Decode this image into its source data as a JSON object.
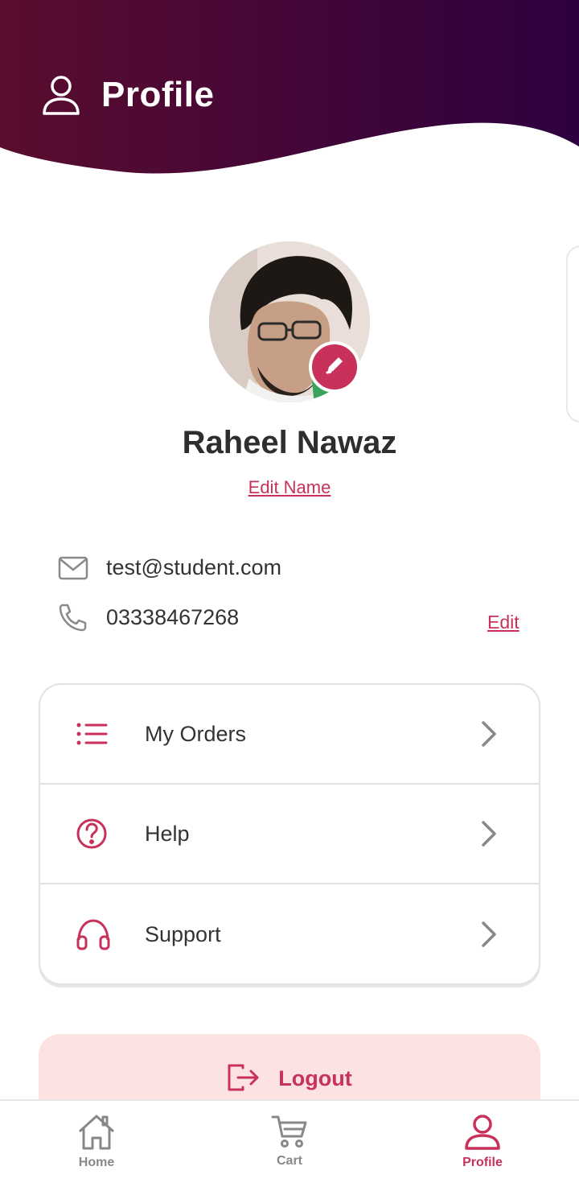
{
  "colors": {
    "accent": "#c8315a",
    "header_gradient_start": "#5a0d2e",
    "header_gradient_end": "#2e0040",
    "logout_bg": "#fde2e2"
  },
  "header": {
    "title": "Profile",
    "icon": "person-icon"
  },
  "profile": {
    "name": "Raheel Nawaz",
    "edit_name_label": "Edit Name",
    "email": "test@student.com",
    "phone": "03338467268",
    "edit_contact_label": "Edit"
  },
  "menu": [
    {
      "label": "My Orders",
      "icon": "list-icon"
    },
    {
      "label": "Help",
      "icon": "help-circle-icon"
    },
    {
      "label": "Support",
      "icon": "headphones-icon"
    }
  ],
  "logout": {
    "label": "Logout",
    "icon": "logout-icon"
  },
  "bottom_nav": [
    {
      "label": "Home",
      "icon": "home-icon",
      "active": false
    },
    {
      "label": "Cart",
      "icon": "cart-icon",
      "active": false
    },
    {
      "label": "Profile",
      "icon": "person-icon",
      "active": true
    }
  ]
}
